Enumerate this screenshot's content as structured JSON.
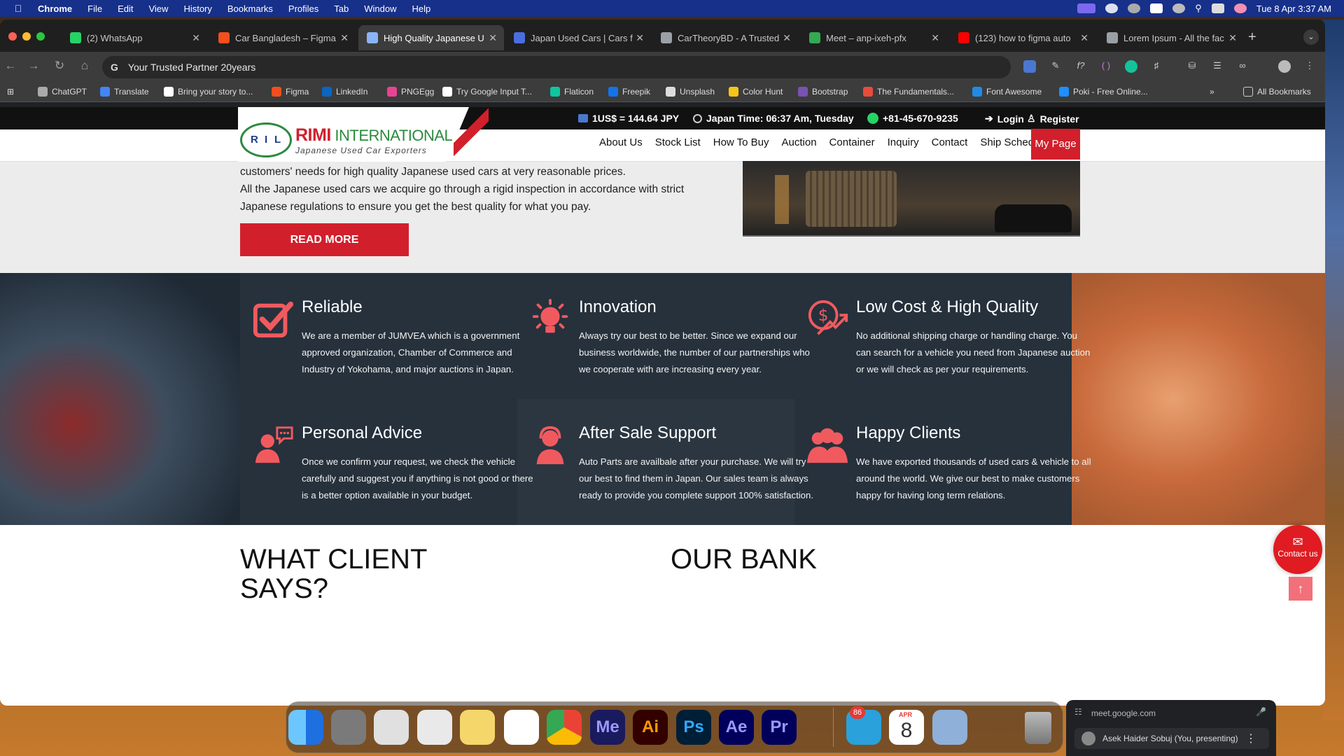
{
  "menubar": {
    "app": "Chrome",
    "items": [
      "File",
      "Edit",
      "View",
      "History",
      "Bookmarks",
      "Profiles",
      "Tab",
      "Window",
      "Help"
    ],
    "datetime": "Tue 8 Apr  3:37 AM"
  },
  "tabs": [
    {
      "label": "(2) WhatsApp",
      "color": "#25d366"
    },
    {
      "label": "Car Bangladesh – Figma",
      "color": "#f24e1e"
    },
    {
      "label": "High Quality Japanese U",
      "color": "#8ab4f8"
    },
    {
      "label": "Japan Used Cars | Cars f",
      "color": "#4a6ee0"
    },
    {
      "label": "CarTheoryBD - A Trusted",
      "color": "#9aa0a6"
    },
    {
      "label": "Meet – anp-ixeh-pfx",
      "color": "#34a853"
    },
    {
      "label": "(123) how to figma auto",
      "color": "#ff0000"
    },
    {
      "label": "Lorem Ipsum - All the fac",
      "color": "#9aa0a6"
    }
  ],
  "address": {
    "text": "Your Trusted Partner 20years"
  },
  "bookmarks": [
    {
      "label": "ChatGPT",
      "color": "#aaaaaa"
    },
    {
      "label": "Translate",
      "color": "#4285f4"
    },
    {
      "label": "Bring your story to...",
      "color": "#ffffff"
    },
    {
      "label": "Figma",
      "color": "#f24e1e"
    },
    {
      "label": "LinkedIn",
      "color": "#0a66c2"
    },
    {
      "label": "PNGEgg",
      "color": "#e84393"
    },
    {
      "label": "Try Google Input T...",
      "color": "#ffffff"
    },
    {
      "label": "Flaticon",
      "color": "#0fc6a0"
    },
    {
      "label": "Freepik",
      "color": "#1273eb"
    },
    {
      "label": "Unsplash",
      "color": "#dddddd"
    },
    {
      "label": "Color Hunt",
      "color": "#f5c518"
    },
    {
      "label": "Bootstrap",
      "color": "#7952b3"
    },
    {
      "label": "The Fundamentals...",
      "color": "#e74c3c"
    },
    {
      "label": "Font Awesome",
      "color": "#228ae6"
    },
    {
      "label": "Poki - Free Online...",
      "color": "#1e90ff"
    }
  ],
  "all_bookmarks": "All Bookmarks",
  "site": {
    "rate": "1US$ = 144.64 JPY",
    "japan_time": "Japan Time: 06:37 Am, Tuesday",
    "phone": "+81-45-670-9235",
    "login": "Login",
    "register": "Register",
    "logo_emblem": [
      "R",
      "I",
      "L"
    ],
    "logo_title_1": "RIMI",
    "logo_title_2": " INTERNATIONAL",
    "logo_sub": "Japanese Used Car Exporters",
    "nav": [
      "About Us",
      "Stock List",
      "How To Buy",
      "Auction",
      "Container",
      "Inquiry",
      "Contact",
      "Ship Schedule"
    ],
    "my_page": "My Page",
    "about_lines": [
      "customers' needs for high quality Japanese used cars at very reasonable prices.",
      "All the Japanese used cars we acquire go through a rigid inspection in accordance with strict",
      "Japanese regulations to ensure you get the best quality for what you pay."
    ],
    "read_more": "READ MORE",
    "accent": "#d21f2c",
    "icon_color": "#f05a5f",
    "features": [
      {
        "title": "Reliable",
        "icon": "check-square-icon",
        "text": "We are a member of JUMVEA which is a government approved organization, Chamber of Commerce and Industry of Yokohama, and major auctions in Japan."
      },
      {
        "title": "Innovation",
        "icon": "lightbulb-icon",
        "text": "Always try our best to be better. Since we expand our business worldwide, the number of our partnerships who we cooperate with are increasing every year."
      },
      {
        "title": "Low Cost & High Quality",
        "icon": "dollar-growth-icon",
        "text": "No additional shipping charge or handling charge. You can search for a vehicle you need from Japanese auction or we will check as per your requirements."
      },
      {
        "title": "Personal Advice",
        "icon": "advice-icon",
        "text": "Once we confirm your request, we check the vehicle carefully and suggest you if anything is not good or there is a better option available in your budget."
      },
      {
        "title": "After Sale Support",
        "icon": "support-agent-icon",
        "text": "Auto Parts are availbale after your purchase. We will try our best to find them in Japan. Our sales team is always ready to provide you complete support 100% satisfaction."
      },
      {
        "title": "Happy Clients",
        "icon": "group-users-icon",
        "text": "We have exported thousands of used cars & vehicle to all around the world. We give our best to make customers happy for having long term relations."
      }
    ],
    "what_client_1": "WHAT CLIENT",
    "what_client_2": "SAYS?",
    "our_bank": "OUR BANK",
    "contact_us": "Contact us"
  },
  "dock": {
    "apps": [
      {
        "name": "finder",
        "label": "",
        "color": "#2f8ff0"
      },
      {
        "name": "settings",
        "label": "",
        "color": "#7a7a7a"
      },
      {
        "name": "launchpad",
        "label": "",
        "color": "#e0e0e0"
      },
      {
        "name": "safari",
        "label": "",
        "color": "#e9e9e9"
      },
      {
        "name": "notes",
        "label": "",
        "color": "#f5d66a"
      },
      {
        "name": "freeform",
        "label": "",
        "color": "#ffffff"
      },
      {
        "name": "chrome",
        "label": "",
        "color": "#ffffff"
      },
      {
        "name": "media-encoder",
        "label": "Me",
        "color": "#1a1a5e"
      },
      {
        "name": "illustrator",
        "label": "Ai",
        "color": "#330000"
      },
      {
        "name": "photoshop",
        "label": "Ps",
        "color": "#001e36"
      },
      {
        "name": "after-effects",
        "label": "Ae",
        "color": "#00005b"
      },
      {
        "name": "premiere",
        "label": "Pr",
        "color": "#00005b"
      },
      {
        "name": "telegram",
        "label": "",
        "color": "#2aa1da"
      },
      {
        "name": "calendar",
        "label": "8",
        "color": "#ffffff"
      },
      {
        "name": "preview",
        "label": "",
        "color": "#8fb0d8"
      }
    ],
    "telegram_badge": "86",
    "calendar_month": "APR"
  },
  "meet": {
    "url": "meet.google.com",
    "presenter": "Asek Haider Sobuj (You, presenting)"
  }
}
